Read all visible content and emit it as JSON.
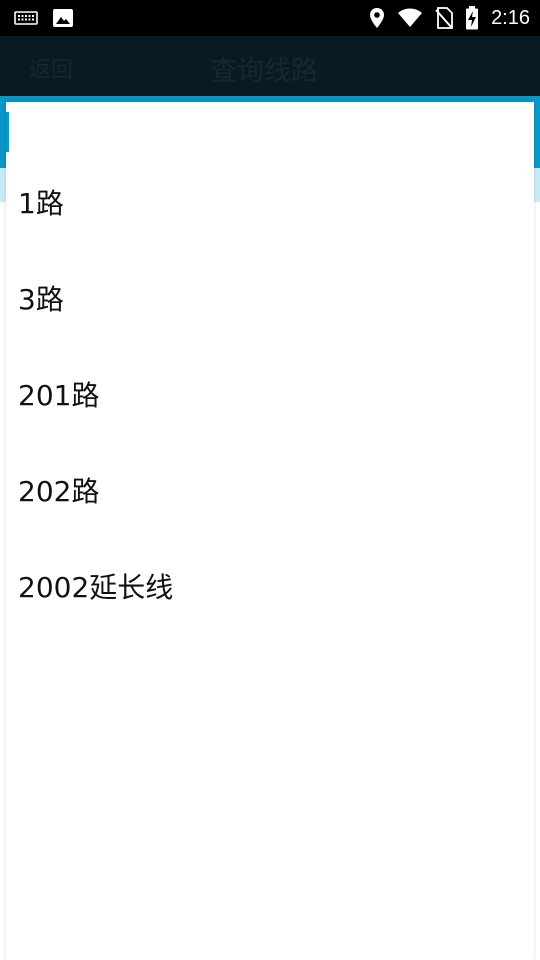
{
  "status_bar": {
    "time": "2:16",
    "icons_left": [
      "keyboard-icon",
      "image-icon"
    ],
    "icons_right": [
      "location-icon",
      "wifi-icon",
      "no-sim-icon",
      "battery-charging-icon"
    ]
  },
  "header": {
    "back_label": "返回",
    "title": "查询线路"
  },
  "dropdown": {
    "items": [
      {
        "label": "1路"
      },
      {
        "label": "3路"
      },
      {
        "label": "201路"
      },
      {
        "label": "202路"
      },
      {
        "label": "2002延长线"
      }
    ]
  },
  "colors": {
    "status_bar": "#000000",
    "title_bar_dimmed": "#0a1a23",
    "accent_blue": "#0a96c8",
    "light_blue": "#c8eaf7",
    "popup_bg": "#ffffff",
    "item_text": "#111111"
  }
}
